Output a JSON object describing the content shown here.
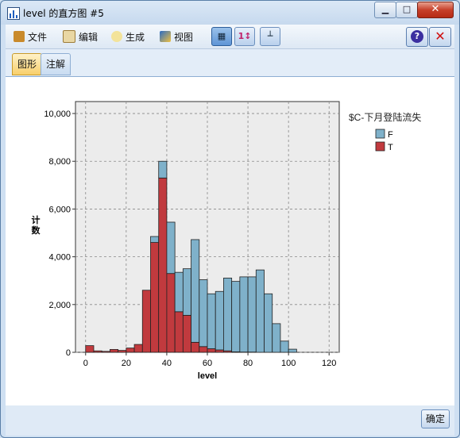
{
  "window": {
    "title": "level 的直方图 #5",
    "controls": {
      "minimize": "▁",
      "maximize": "□",
      "close": "✕"
    }
  },
  "toolbar": {
    "menus": [
      {
        "label": "文件",
        "icon": "file-folder-icon"
      },
      {
        "label": "编辑",
        "icon": "edit-page-icon"
      },
      {
        "label": "生成",
        "icon": "generate-hand-icon"
      },
      {
        "label": "视图",
        "icon": "view-brush-icon"
      }
    ],
    "help_label": "?",
    "close_label": "✕"
  },
  "tabs": [
    {
      "label": "图形",
      "active": true
    },
    {
      "label": "注解",
      "active": false
    }
  ],
  "footer": {
    "ok_label": "确定"
  },
  "colors": {
    "F": "#7fb1ca",
    "T": "#c13a3e",
    "plot_bg": "#ececec"
  },
  "chart_data": {
    "type": "bar",
    "stacked": true,
    "xlabel": "level",
    "ylabel": "计数",
    "xlim": [
      -5,
      125
    ],
    "ylim": [
      0,
      10500
    ],
    "xticks": [
      0,
      20,
      40,
      60,
      80,
      100,
      120
    ],
    "yticks": [
      0,
      2000,
      4000,
      6000,
      8000,
      10000
    ],
    "ytick_labels": [
      "0",
      "2,000",
      "4,000",
      "6,000",
      "8,000",
      "10,000"
    ],
    "grid": true,
    "legend_title": "$C-下月登陆流失",
    "legend_position": "right",
    "bin_width": 4,
    "bin_starts": [
      0,
      4,
      8,
      12,
      16,
      20,
      24,
      28,
      32,
      36,
      40,
      44,
      48,
      52,
      56,
      60,
      64,
      68,
      72,
      76,
      80,
      84,
      88,
      92,
      96,
      100
    ],
    "series": [
      {
        "name": "F",
        "values": [
          0,
          0,
          0,
          0,
          0,
          0,
          0,
          0,
          250,
          700,
          2150,
          1650,
          1950,
          4300,
          2800,
          2300,
          2450,
          3050,
          2950,
          3150,
          3150,
          3450,
          2450,
          1200,
          470,
          130
        ]
      },
      {
        "name": "T",
        "values": [
          280,
          60,
          40,
          120,
          80,
          180,
          330,
          2600,
          4600,
          7300,
          3300,
          1700,
          1550,
          420,
          240,
          150,
          100,
          60,
          20,
          10,
          10,
          0,
          0,
          0,
          0,
          0
        ]
      }
    ]
  }
}
